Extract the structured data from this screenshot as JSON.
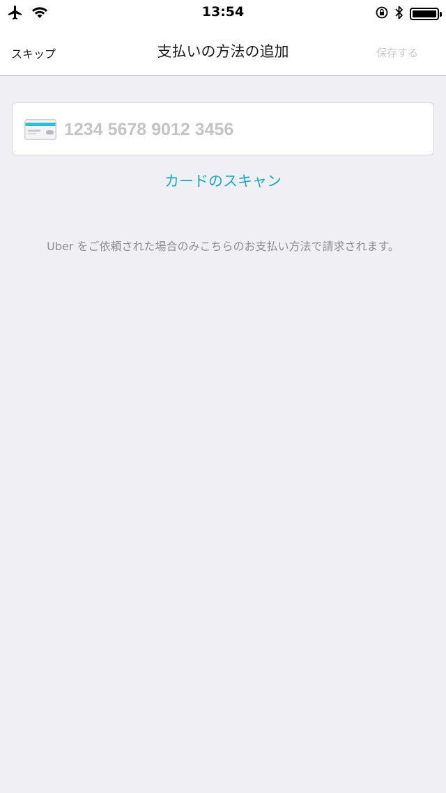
{
  "status_bar": {
    "time": "13:54",
    "icons": [
      "airplane-icon",
      "wifi-icon",
      "orientation-lock-icon",
      "bluetooth-icon",
      "battery-icon"
    ]
  },
  "nav": {
    "skip_label": "スキップ",
    "title": "支払いの方法の追加",
    "save_label": "保存する"
  },
  "card_field": {
    "placeholder": "1234 5678 9012 3456",
    "value": "",
    "icon": "credit-card-icon"
  },
  "scan_link": "カードのスキャン",
  "info_text": "Uber をご依頼された場合のみこちらのお支払い方法で請求されます。",
  "colors": {
    "accent": "#1aa6c8",
    "background": "#efeff4",
    "disabled": "#c7c7cc"
  }
}
